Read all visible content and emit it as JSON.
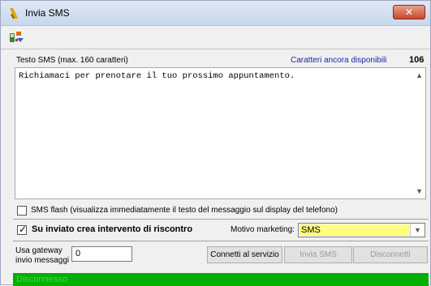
{
  "window": {
    "title": "Invia SMS",
    "close_glyph": "✕",
    "accent": "#c9492c"
  },
  "toolbar": {
    "icons": [
      "sms-app-icon"
    ]
  },
  "message": {
    "label": "Testo SMS (max. 160 caratteri)",
    "remaining_label": "Caratteri ancora disponibili",
    "remaining_count": "106",
    "text": "Richiamaci per prenotare il tuo prossimo appuntamento."
  },
  "flash": {
    "label": "SMS flash (visualizza immediatamente il testo del messaggio sul display del telefono)",
    "checked": false
  },
  "intervento": {
    "label": "Su inviato crea intervento di riscontro",
    "checked": true
  },
  "marketing": {
    "label": "Motivo marketing:",
    "value": "SMS",
    "highlight": "#ffff80"
  },
  "gateway": {
    "label_line1": "Usa  gateway",
    "label_line2": "invio messaggi",
    "value": "0"
  },
  "buttons": {
    "connect": "Connetti al servizio",
    "send": "Invia SMS",
    "disconnect": "Disconnetti"
  },
  "status": {
    "text": "Disconnesso",
    "color": "#00b000"
  }
}
